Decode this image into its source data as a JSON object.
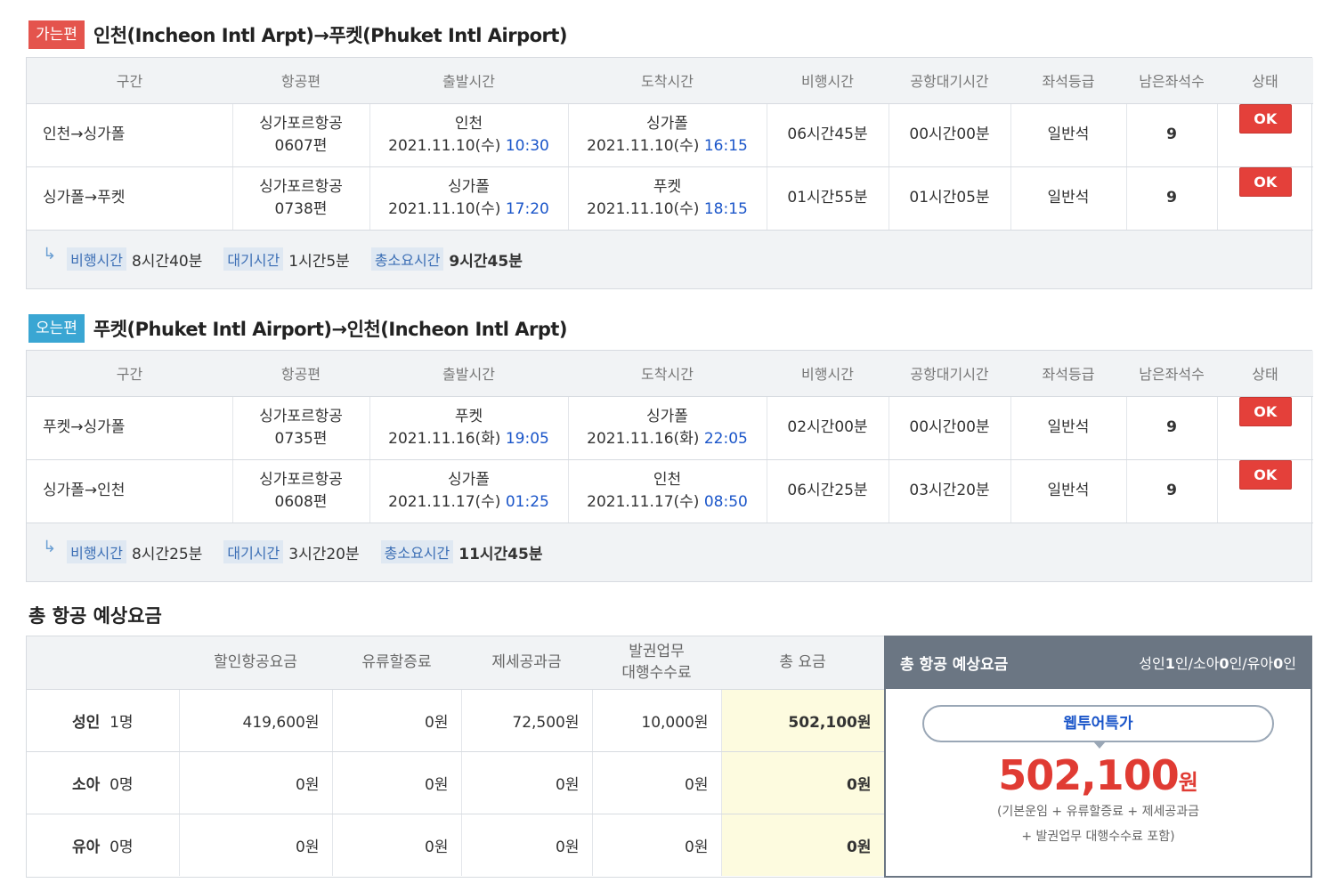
{
  "outbound": {
    "badge": "가는편",
    "title": "인천(Incheon Intl Arpt)→푸켓(Phuket Intl Airport)",
    "headers": [
      "구간",
      "항공편",
      "출발시간",
      "도착시간",
      "비행시간",
      "공항대기시간",
      "좌석등급",
      "남은좌석수",
      "상태"
    ],
    "rows": [
      {
        "segment": "인천→싱가폴",
        "airline": "싱가포르항공",
        "flight_no": "0607편",
        "dep_city": "인천",
        "dep_date": "2021.11.10(수)",
        "dep_time": "10:30",
        "arr_city": "싱가폴",
        "arr_date": "2021.11.10(수)",
        "arr_time": "16:15",
        "flight_time": "06시간45분",
        "wait_time": "00시간00분",
        "class": "일반석",
        "seats": "9",
        "status": "OK"
      },
      {
        "segment": "싱가폴→푸켓",
        "airline": "싱가포르항공",
        "flight_no": "0738편",
        "dep_city": "싱가폴",
        "dep_date": "2021.11.10(수)",
        "dep_time": "17:20",
        "arr_city": "푸켓",
        "arr_date": "2021.11.10(수)",
        "arr_time": "18:15",
        "flight_time": "01시간55분",
        "wait_time": "01시간05분",
        "class": "일반석",
        "seats": "9",
        "status": "OK"
      }
    ],
    "summary": {
      "arrow": "↳",
      "flight_label": "비행시간",
      "flight_value": "8시간40분",
      "wait_label": "대기시간",
      "wait_value": "1시간5분",
      "total_label": "총소요시간",
      "total_value": "9시간45분"
    }
  },
  "inbound": {
    "badge": "오는편",
    "title": "푸켓(Phuket Intl Airport)→인천(Incheon Intl Arpt)",
    "headers": [
      "구간",
      "항공편",
      "출발시간",
      "도착시간",
      "비행시간",
      "공항대기시간",
      "좌석등급",
      "남은좌석수",
      "상태"
    ],
    "rows": [
      {
        "segment": "푸켓→싱가폴",
        "airline": "싱가포르항공",
        "flight_no": "0735편",
        "dep_city": "푸켓",
        "dep_date": "2021.11.16(화)",
        "dep_time": "19:05",
        "arr_city": "싱가폴",
        "arr_date": "2021.11.16(화)",
        "arr_time": "22:05",
        "flight_time": "02시간00분",
        "wait_time": "00시간00분",
        "class": "일반석",
        "seats": "9",
        "status": "OK"
      },
      {
        "segment": "싱가폴→인천",
        "airline": "싱가포르항공",
        "flight_no": "0608편",
        "dep_city": "싱가폴",
        "dep_date": "2021.11.17(수)",
        "dep_time": "01:25",
        "arr_city": "인천",
        "arr_date": "2021.11.17(수)",
        "arr_time": "08:50",
        "flight_time": "06시간25분",
        "wait_time": "03시간20분",
        "class": "일반석",
        "seats": "9",
        "status": "OK"
      }
    ],
    "summary": {
      "arrow": "↳",
      "flight_label": "비행시간",
      "flight_value": "8시간25분",
      "wait_label": "대기시간",
      "wait_value": "3시간20분",
      "total_label": "총소요시간",
      "total_value": "11시간45분"
    }
  },
  "fare": {
    "title": "총 항공 예상요금",
    "headers": [
      "",
      "할인항공요금",
      "유류할증료",
      "제세공과금",
      "발권업무\n대행수수료",
      "총 요금"
    ],
    "header_fee_line1": "발권업무",
    "header_fee_line2": "대행수수료",
    "rows": [
      {
        "type": "성인",
        "count": "1명",
        "base": "419,600원",
        "fuel": "0원",
        "tax": "72,500원",
        "fee": "10,000원",
        "total": "502,100원"
      },
      {
        "type": "소아",
        "count": "0명",
        "base": "0원",
        "fuel": "0원",
        "tax": "0원",
        "fee": "0원",
        "total": "0원"
      },
      {
        "type": "유아",
        "count": "0명",
        "base": "0원",
        "fuel": "0원",
        "tax": "0원",
        "fee": "0원",
        "total": "0원"
      }
    ],
    "panel": {
      "title": "총 항공 예상요금",
      "pax_prefix1": "성인",
      "pax_n1": "1",
      "pax_mid1": "인/소아",
      "pax_n2": "0",
      "pax_mid2": "인/유아",
      "pax_n3": "0",
      "pax_suffix": "인",
      "special_label": "웹투어특가",
      "price": "502,100",
      "currency": "원",
      "note_line1": "(기본운임 + 유류할증료 + 제세공과금",
      "note_line2": "+ 발권업무 대행수수료 포함)"
    }
  },
  "colors": {
    "go_badge": "#e4544d",
    "back_badge": "#3aa6d3",
    "ok": "#e4403a",
    "time_blue": "#1a55c9",
    "price_red": "#e03b33"
  }
}
